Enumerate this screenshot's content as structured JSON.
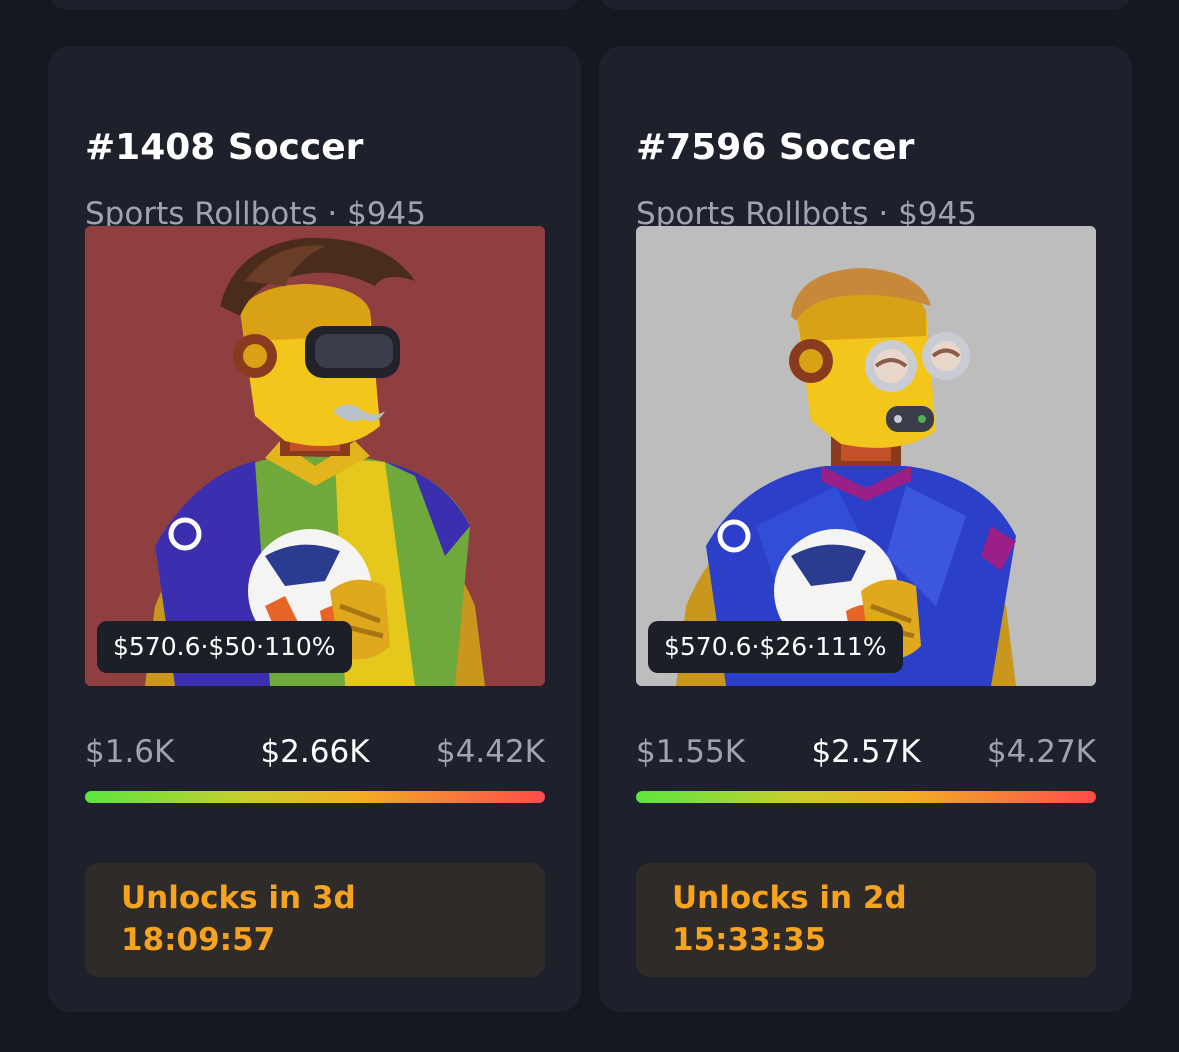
{
  "cards": [
    {
      "title": "#1408 Soccer",
      "subtitle": "Sports Rollbots · $945",
      "image_background": "#8f3f40",
      "stats": "$570.6·$50·110%",
      "prices": {
        "low": "$1.6K",
        "mid": "$2.66K",
        "high": "$4.42K"
      },
      "unlock_label": "Unlocks in 3d",
      "unlock_timer": "18:09:57"
    },
    {
      "title": "#7596 Soccer",
      "subtitle": "Sports Rollbots · $945",
      "image_background": "#bdbdbd",
      "stats": "$570.6·$26·111%",
      "prices": {
        "low": "$1.55K",
        "mid": "$2.57K",
        "high": "$4.27K"
      },
      "unlock_label": "Unlocks in 2d",
      "unlock_timer": "15:33:35"
    }
  ],
  "colors": {
    "page_background": "#161821",
    "card_background": "#1e212c",
    "accent_orange": "#f6a31f",
    "muted_text": "#9ea2b3",
    "bar_start": "#5ce53e",
    "bar_end": "#ff4b4b"
  }
}
